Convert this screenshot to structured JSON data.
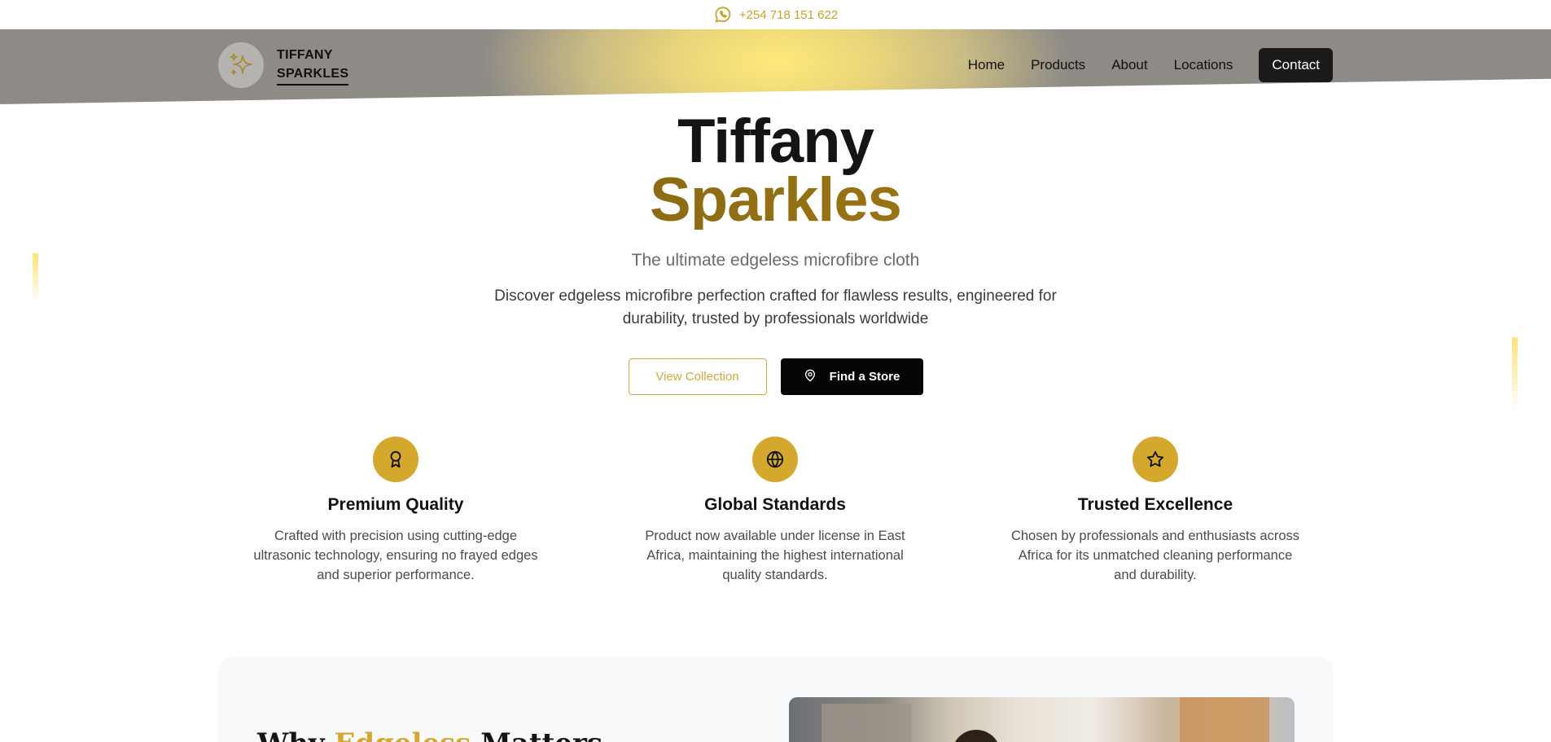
{
  "topbar": {
    "phone": "+254 718 151 622",
    "icon": "whatsapp-icon"
  },
  "header": {
    "brand_line1": "TIFFANY",
    "brand_line2": "SPARKLES",
    "logo_icon": "sparkles-icon",
    "nav": [
      "Home",
      "Products",
      "About",
      "Locations"
    ],
    "contact_label": "Contact"
  },
  "hero": {
    "title_line1": "Tiffany",
    "title_line2": "Sparkles",
    "subtitle": "The ultimate edgeless microfibre cloth",
    "description": "Discover edgeless microfibre perfection crafted for flawless results, engineered for durability, trusted by professionals worldwide",
    "btn_view": "View Collection",
    "btn_store": "Find a Store",
    "btn_store_icon": "map-pin-icon"
  },
  "features": [
    {
      "icon": "award-icon",
      "title": "Premium Quality",
      "text": "Crafted with precision using cutting-edge ultrasonic technology, ensuring no frayed edges and superior performance."
    },
    {
      "icon": "globe-icon",
      "title": "Global Standards",
      "text": "Product now available under license in East Africa, maintaining the highest international quality standards."
    },
    {
      "icon": "star-icon",
      "title": "Trusted Excellence",
      "text": "Chosen by professionals and enthusiasts across Africa for its unmatched cleaning performance and durability."
    }
  ],
  "why": {
    "title_pre": "Why ",
    "title_gold": "Edgeless",
    "title_post": " Matters"
  },
  "colors": {
    "gold": "#d4a82c",
    "dark": "#111111",
    "header_glow": "#ffe97a"
  }
}
